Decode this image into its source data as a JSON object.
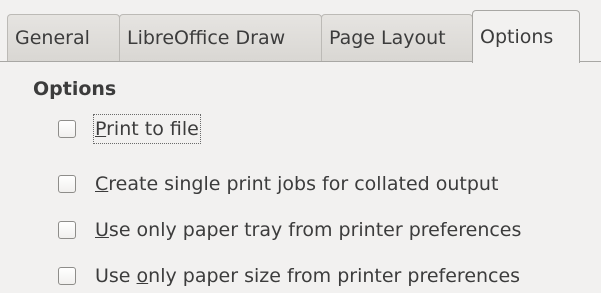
{
  "tabs": [
    {
      "label": "General",
      "active": false
    },
    {
      "label": "LibreOffice Draw",
      "active": false
    },
    {
      "label": "Page Layout",
      "active": false
    },
    {
      "label": "Options",
      "active": true
    }
  ],
  "options_section": {
    "title": "Options",
    "items": [
      {
        "mnemonic": "P",
        "rest": "rint to file",
        "checked": false
      },
      {
        "mnemonic": "C",
        "rest": "reate single print jobs for collated output",
        "checked": false
      },
      {
        "mnemonic": "U",
        "rest": "se only paper tray from printer preferences",
        "checked": false
      },
      {
        "prefix": "Use ",
        "mnemonic": "o",
        "rest": "nly paper size from printer preferences",
        "checked": false
      }
    ]
  }
}
